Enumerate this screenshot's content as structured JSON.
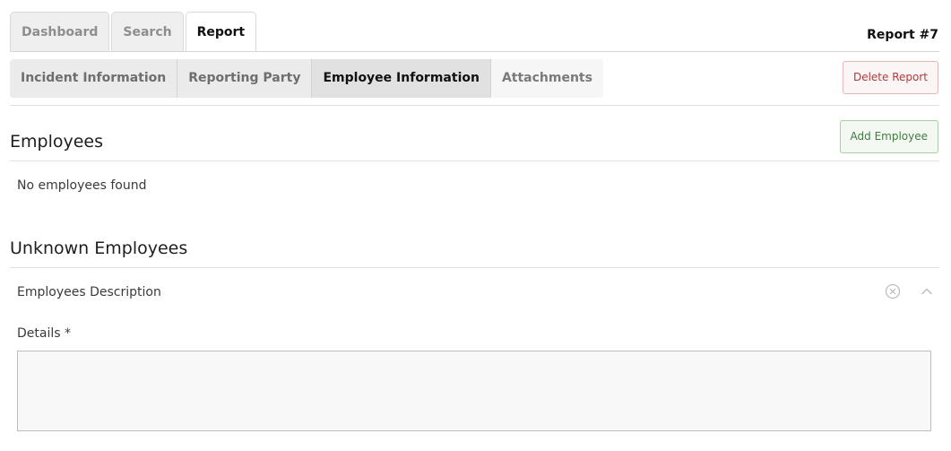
{
  "top_tabs": [
    {
      "label": "Dashboard",
      "active": false
    },
    {
      "label": "Search",
      "active": false
    },
    {
      "label": "Report",
      "active": true
    }
  ],
  "report_number": "Report #7",
  "sub_tabs": [
    {
      "label": "Incident Information"
    },
    {
      "label": "Reporting Party"
    },
    {
      "label": "Employee Information"
    },
    {
      "label": "Attachments"
    }
  ],
  "buttons": {
    "delete_report": "Delete Report",
    "add_employee": "Add Employee"
  },
  "employees": {
    "title": "Employees",
    "empty_message": "No employees found"
  },
  "unknown_employees": {
    "title": "Unknown Employees",
    "panel_title": "Employees Description",
    "details_label": "Details *",
    "details_value": ""
  },
  "colors": {
    "delete": "#b33a3a",
    "add": "#3e7c3e"
  },
  "icons": {
    "clear": "close-circle-icon",
    "collapse": "chevron-up-icon"
  }
}
